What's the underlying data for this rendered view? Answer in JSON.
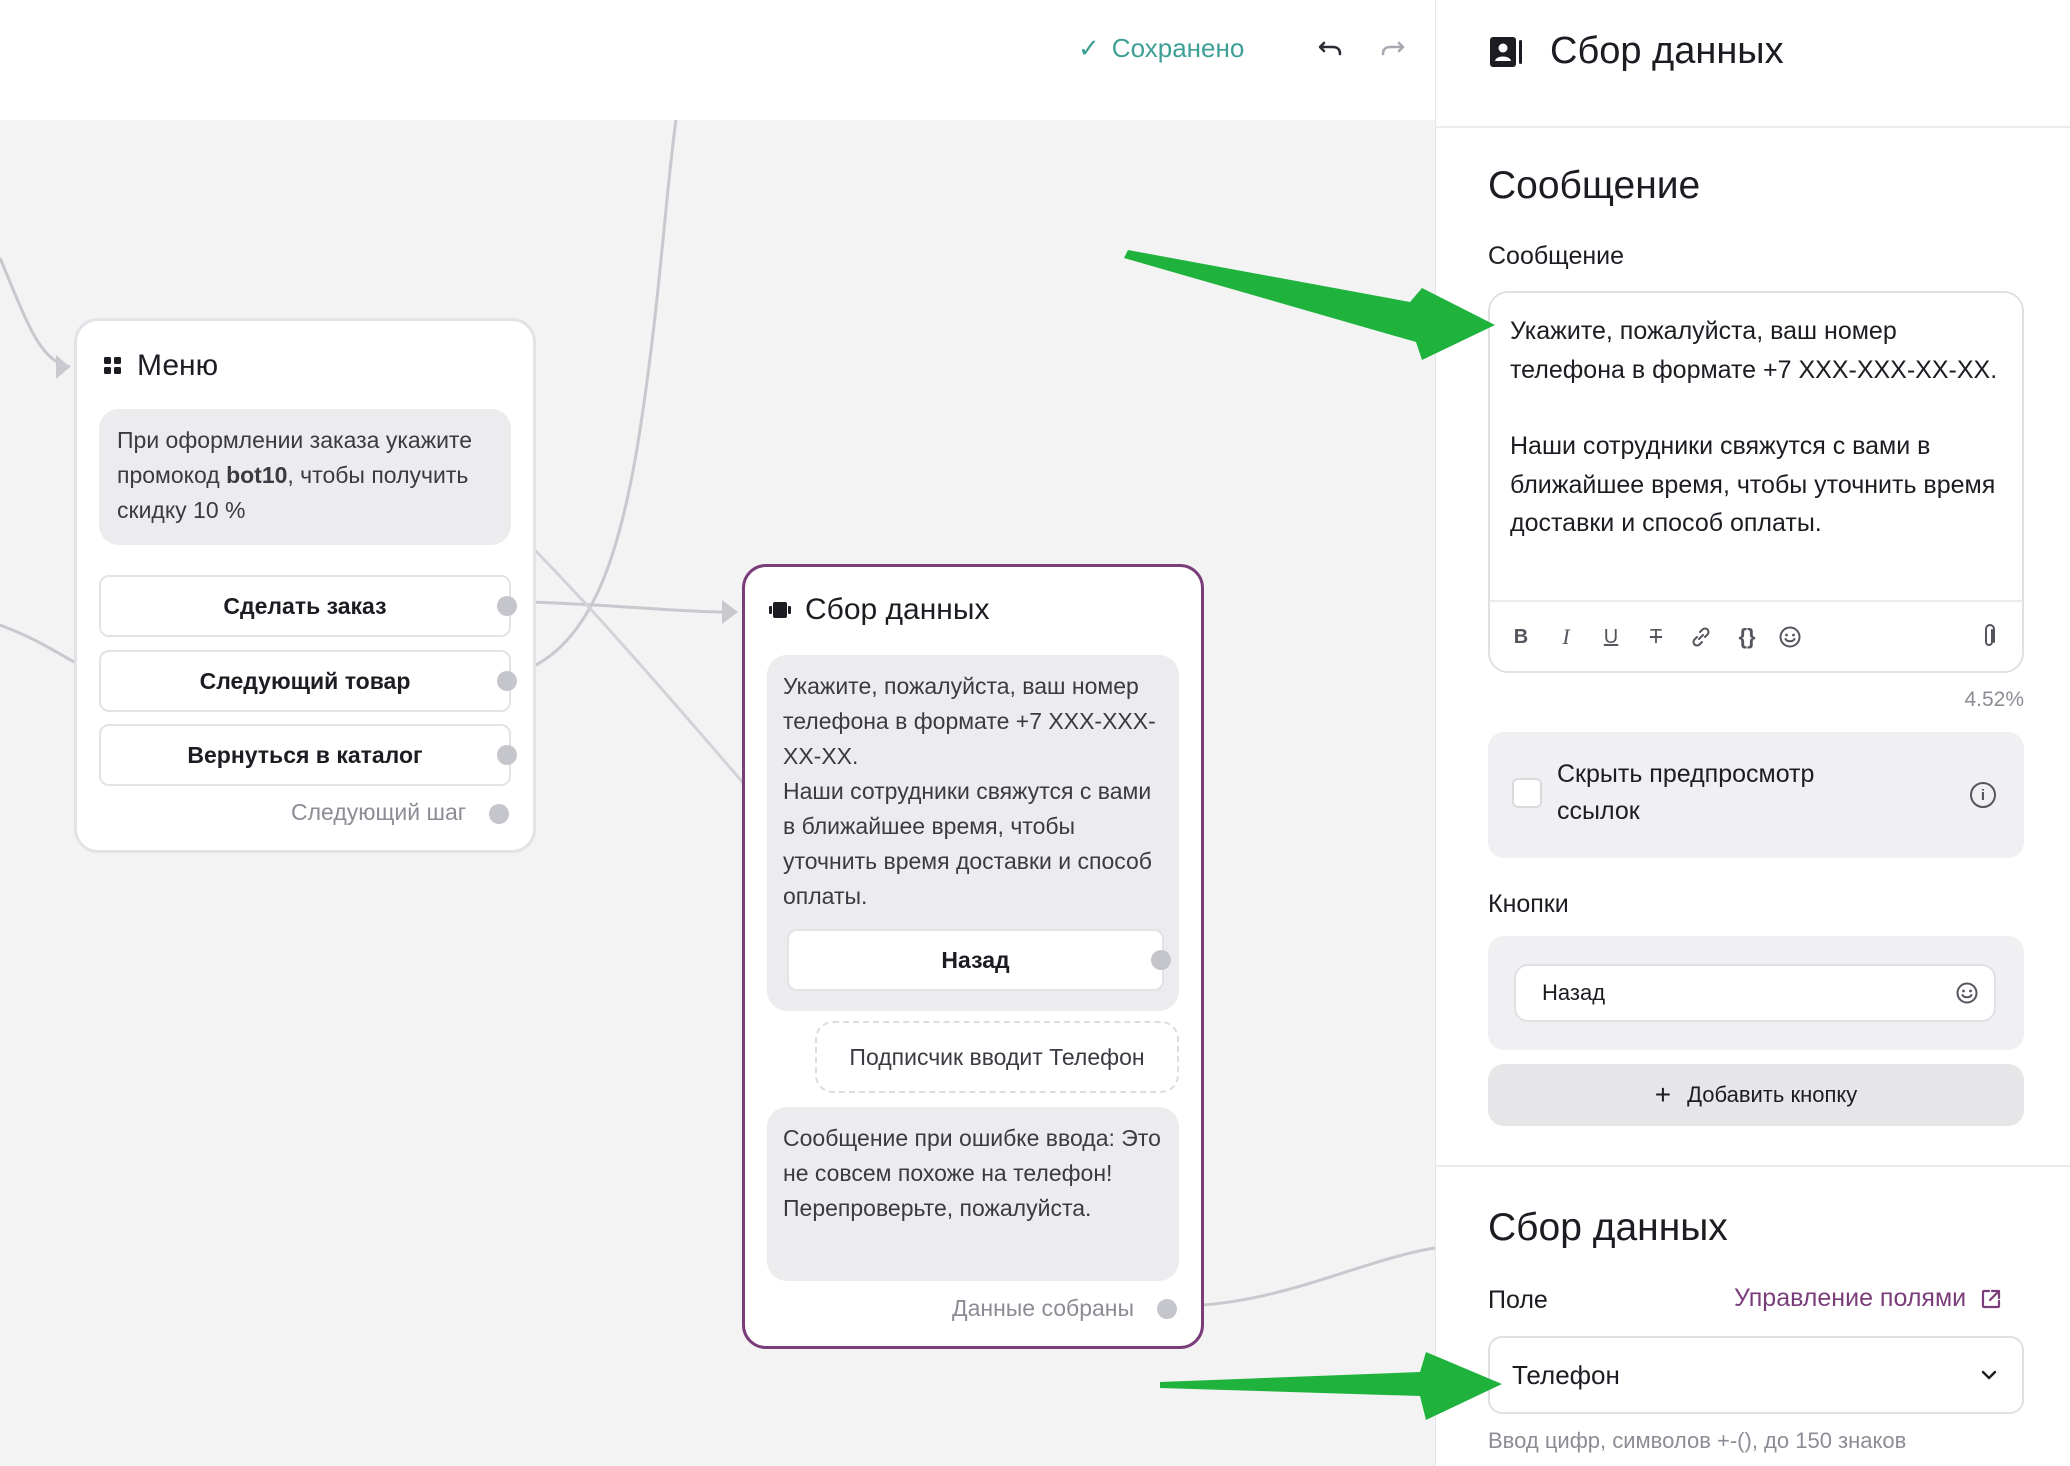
{
  "header": {
    "status": "Сохранено",
    "undo_icon": "undo-icon",
    "redo_icon": "redo-icon"
  },
  "menu_node": {
    "title": "Меню",
    "text_before": "При оформлении заказа укажите промокод ",
    "text_bold": "bot10",
    "text_after": ", чтобы получить скидку 10 %",
    "buttons": [
      "Сделать заказ",
      "Следующий товар",
      "Вернуться в каталог"
    ],
    "next_step": "Следующий шаг"
  },
  "collect_node": {
    "title": "Сбор данных",
    "message_line1": "Укажите, пожалуйста, ваш номер телефона в формате +7 XXX-XXX-XX-XX.",
    "message_line2": "Наши сотрудники свяжутся с вами в ближайшее время, чтобы уточнить время доставки и способ оплаты.",
    "button": "Назад",
    "input_hint": "Подписчик вводит Телефон",
    "error_message": "Сообщение при ошибке ввода: Это не совсем похоже на телефон! Перепроверьте, пожалуйста.",
    "collected": "Данные собраны"
  },
  "panel": {
    "title": "Сбор данных",
    "message_section": "Сообщение",
    "message_label": "Сообщение",
    "message_para1": "Укажите, пожалуйста, ваш номер телефона в формате +7 XXX-XXX-XX-XX.",
    "message_para2": "Наши сотрудники свяжутся с вами в ближайшее время, чтобы уточнить время доставки и способ оплаты.",
    "toolbar": [
      "B",
      "I",
      "U",
      "T",
      "link",
      "{}",
      "emoji",
      "attach"
    ],
    "percent": "4.52%",
    "hide_preview": "Скрыть предпросмотр ссылок",
    "buttons_label": "Кнопки",
    "button_value": "Назад",
    "add_button": "Добавить кнопку",
    "collect_section": "Сбор данных",
    "field_label": "Поле",
    "manage_fields": "Управление полями",
    "field_value": "Телефон",
    "field_hint": "Ввод цифр, символов +-(), до 150 знаков"
  },
  "colors": {
    "accent": "#7a3d7a",
    "saved": "#3e9f95",
    "arrow": "#1fb33e",
    "canvas": "#f3f3f4"
  }
}
